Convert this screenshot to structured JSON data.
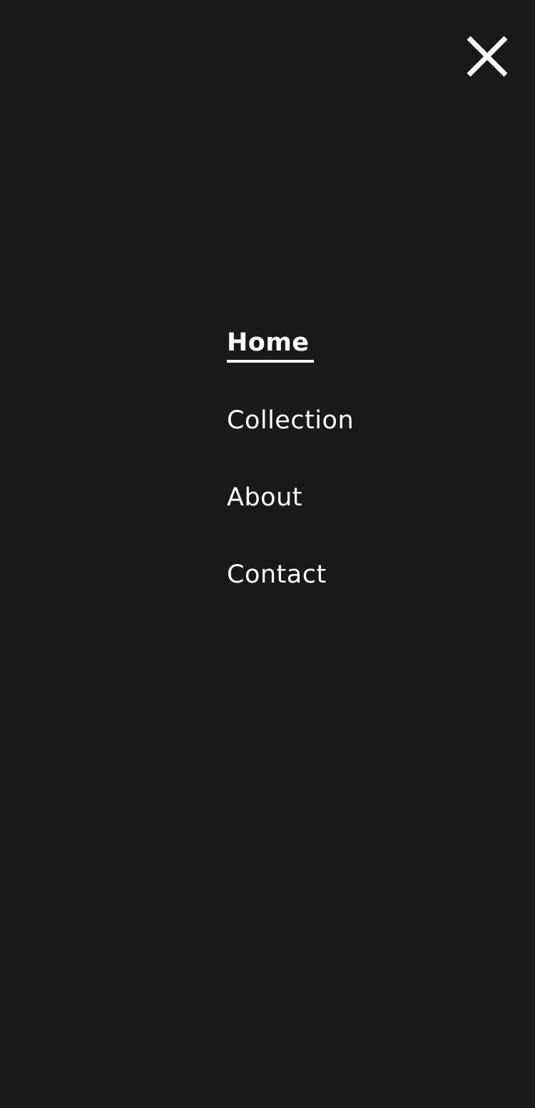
{
  "menu": {
    "close_icon": "close-icon",
    "items": [
      {
        "label": "Home",
        "active": true
      },
      {
        "label": "Collection",
        "active": false
      },
      {
        "label": "About",
        "active": false
      },
      {
        "label": "Contact",
        "active": false
      }
    ]
  },
  "colors": {
    "background": "#19191b",
    "text": "#ffffff"
  }
}
